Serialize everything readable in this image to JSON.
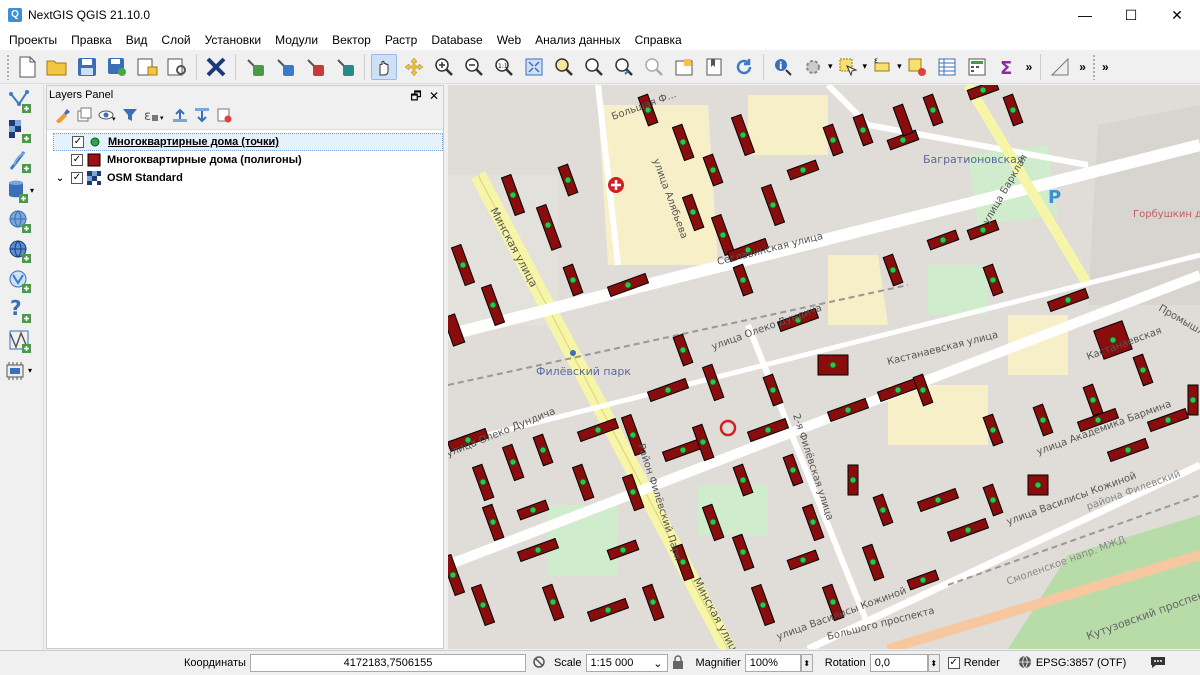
{
  "window": {
    "title": "NextGIS QGIS 21.10.0",
    "minimize": "—",
    "maximize": "☐",
    "close": "✕"
  },
  "menu": [
    "Проекты",
    "Правка",
    "Вид",
    "Слой",
    "Установки",
    "Модули",
    "Вектор",
    "Растр",
    "Database",
    "Web",
    "Анализ данных",
    "Справка"
  ],
  "layers_panel": {
    "title": "Layers Panel",
    "float_icon": "🗗",
    "close_icon": "✕",
    "layers": [
      {
        "name": "Многоквартирные дома (точки)",
        "checked": true,
        "selected": true,
        "symbol": "point",
        "color": "#2aa84a"
      },
      {
        "name": "Многоквартирные дома (полигоны)",
        "checked": true,
        "selected": false,
        "symbol": "polygon",
        "color": "#a01010"
      },
      {
        "name": "OSM Standard",
        "checked": true,
        "selected": false,
        "symbol": "raster",
        "color": "#2a4a8a"
      }
    ]
  },
  "map_labels": {
    "street1": "Большая Ф...",
    "street2": "улица Алябьева",
    "street3": "Минская улица",
    "street4": "Сеславинская улица",
    "street5": "улица Олеко Дундича",
    "street6": "Кастанаевская улица",
    "street7": "Багратионовская",
    "street8": "улица Барклая",
    "street9": "Горбушкин двор",
    "street10": "Филёвский парк",
    "street11": "улица Олеко Дундича",
    "street12": "Район Филёвский Парк",
    "street13": "2-я Филёвская улица",
    "street14": "улица Академика Бармина",
    "street15": "улица Василисы Кожиной",
    "street16": "Смоленское напр. МЖД",
    "street17": "улица Василисы Кожиной",
    "street18": "Минская улица",
    "street19": "Промышленный",
    "street20": "Кутузовский проспекта",
    "street21": "района Филевский",
    "street22": "Кастанаевская",
    "street23": "Большого проспекта",
    "street24": "Кутузовский проспект",
    "street25": "улица Василисы Кожиной"
  },
  "status": {
    "coord_label": "Координаты",
    "coord_value": "4172183,7506155",
    "scale_label": "Scale",
    "scale_value": "1:15 000",
    "magnifier_label": "Magnifier",
    "magnifier_value": "100%",
    "rotation_label": "Rotation",
    "rotation_value": "0,0",
    "render_label": "Render",
    "render_checked": true,
    "crs": "EPSG:3857 (OTF)"
  }
}
